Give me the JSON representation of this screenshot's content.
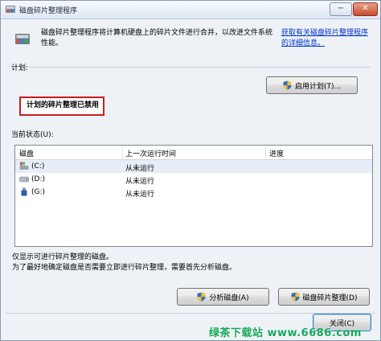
{
  "window": {
    "title": "磁盘碎片整理程序",
    "minimize_glyph": "−",
    "close_glyph": "✕"
  },
  "intro": {
    "text": "磁盘碎片整理程序将计算机硬盘上的碎片文件进行合并，以改进文件系统性能。",
    "link": "获取有关磁盘碎片整理程序的详细信息。"
  },
  "schedule": {
    "label": "计划:",
    "status": "计划的碎片整理已禁用",
    "button": "启用计划(T)..."
  },
  "current_status": {
    "label": "当前状态(U):",
    "columns": [
      "磁盘",
      "上一次运行时间",
      "进度"
    ],
    "rows": [
      {
        "disk": "(C:)",
        "last_run": "从未运行",
        "icon": "system-drive-icon"
      },
      {
        "disk": "(D:)",
        "last_run": "从未运行",
        "icon": "hard-drive-icon"
      },
      {
        "disk": "(G:)",
        "last_run": "从未运行",
        "icon": "usb-drive-icon"
      }
    ]
  },
  "notes": {
    "line1": "仅显示可进行碎片整理的磁盘。",
    "line2": "为了最好地确定磁盘是否需要立即进行碎片整理，需要首先分析磁盘。"
  },
  "buttons": {
    "analyze": "分析磁盘(A)",
    "defragment": "磁盘碎片整理(D)",
    "close": "关闭(C)"
  },
  "watermark": "绿茶下载站 www.6686.com"
}
